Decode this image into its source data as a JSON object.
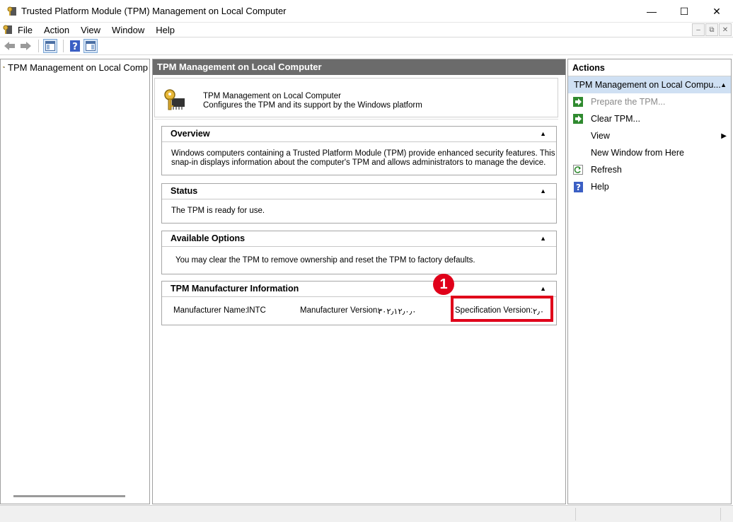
{
  "window": {
    "title": "Trusted Platform Module (TPM) Management on Local Computer",
    "minimize": "—",
    "maximize": "☐",
    "close": "✕"
  },
  "menu": {
    "items": [
      "File",
      "Action",
      "View",
      "Window",
      "Help"
    ],
    "mdi": [
      "–",
      "⧉",
      "✕"
    ]
  },
  "tree": {
    "root_label": "TPM Management on Local Comp"
  },
  "center": {
    "header": "TPM Management on Local Computer",
    "intro_title": "TPM Management on Local Computer",
    "intro_desc": "Configures the TPM and its support by the Windows platform",
    "sections": {
      "overview": {
        "title": "Overview",
        "text1": "Windows computers containing a Trusted Platform Module (TPM) provide enhanced security features. This",
        "text2": "snap-in displays information about the computer's TPM and allows administrators to manage the device."
      },
      "status": {
        "title": "Status",
        "text": "The TPM is ready for use."
      },
      "options": {
        "title": "Available Options",
        "text": "You may clear the TPM to remove ownership and reset the TPM to factory defaults."
      },
      "manufacturer": {
        "title": "TPM Manufacturer Information",
        "name_label": "Manufacturer Name:",
        "name_value": "INTC",
        "version_label": "Manufacturer Version:",
        "version_value": "۳۰۲٫۱۲٫۰٫۰",
        "spec_label": "Specification Version:",
        "spec_value": "۲٫۰",
        "badge": "1"
      }
    },
    "collapse_glyph": "▲"
  },
  "actions": {
    "header": "Actions",
    "group": "TPM Management on Local Compu...",
    "items": [
      {
        "label": "Prepare the TPM...",
        "icon": "green-arrow-icon",
        "disabled": true
      },
      {
        "label": "Clear TPM...",
        "icon": "green-arrow-icon",
        "disabled": false
      },
      {
        "label": "View",
        "icon": "",
        "disabled": false,
        "submenu": "▶"
      },
      {
        "label": "New Window from Here",
        "icon": "",
        "disabled": false
      },
      {
        "label": "Refresh",
        "icon": "refresh-icon",
        "disabled": false
      },
      {
        "label": "Help",
        "icon": "help-icon",
        "disabled": false
      }
    ]
  },
  "colors": {
    "highlight": "#e0001a",
    "header_bg": "#6b6b6b",
    "selection_bg": "#cfe0f3"
  }
}
